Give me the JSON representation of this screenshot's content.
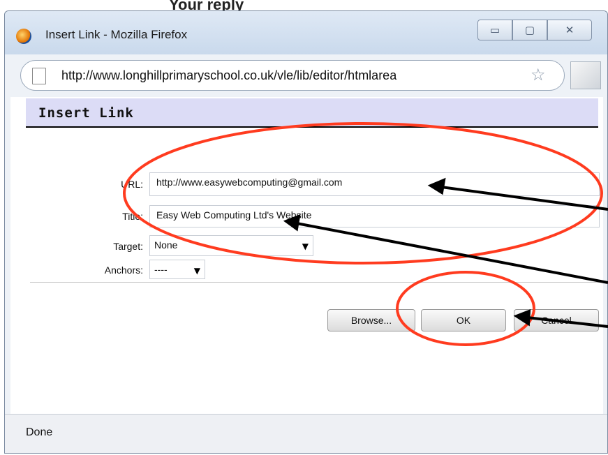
{
  "background": {
    "heading": "Your reply"
  },
  "window": {
    "title": "Insert Link - Mozilla Firefox",
    "buttons": {
      "minimize": "▭",
      "maximize": "▢",
      "close": "✕"
    }
  },
  "address_bar": {
    "url": "http://www.longhillprimaryschool.co.uk/vle/lib/editor/htmlarea"
  },
  "dialog": {
    "header": "Insert Link",
    "fields": {
      "url_label": "URL:",
      "url_value": "http://www.easywebcomputing@gmail.com",
      "title_label": "Title:",
      "title_value": "Easy Web Computing Ltd's Website",
      "target_label": "Target:",
      "target_value": "None",
      "anchors_label": "Anchors:",
      "anchors_value": "----"
    },
    "buttons": {
      "browse": "Browse...",
      "ok": "OK",
      "cancel": "Cancel"
    }
  },
  "status_bar": {
    "text": "Done"
  },
  "colors": {
    "annotation": "#ff3b1f",
    "arrow": "#000000",
    "header_bg": "#dcdcf6"
  }
}
